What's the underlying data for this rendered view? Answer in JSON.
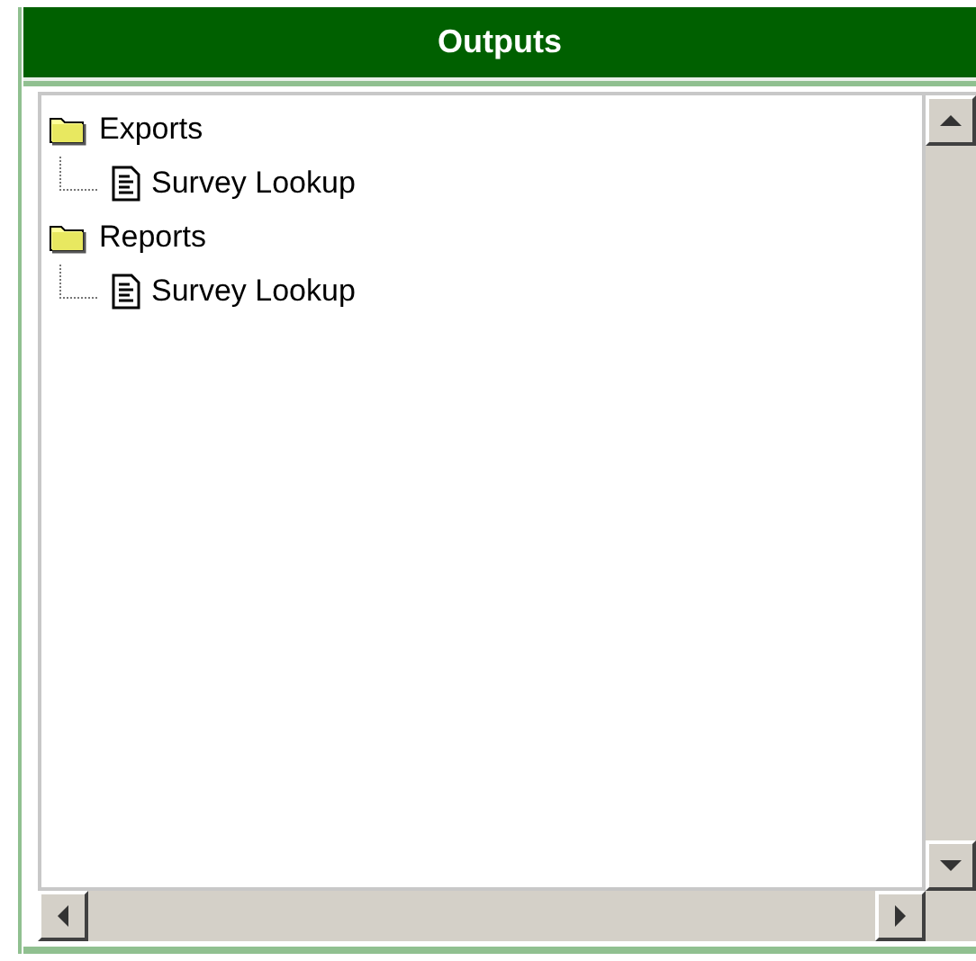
{
  "panel": {
    "title": "Outputs"
  },
  "tree": [
    {
      "kind": "folder",
      "label": "Exports",
      "children": [
        {
          "kind": "document",
          "label": "Survey Lookup"
        }
      ]
    },
    {
      "kind": "folder",
      "label": "Reports",
      "children": [
        {
          "kind": "document",
          "label": "Survey Lookup"
        }
      ]
    }
  ]
}
